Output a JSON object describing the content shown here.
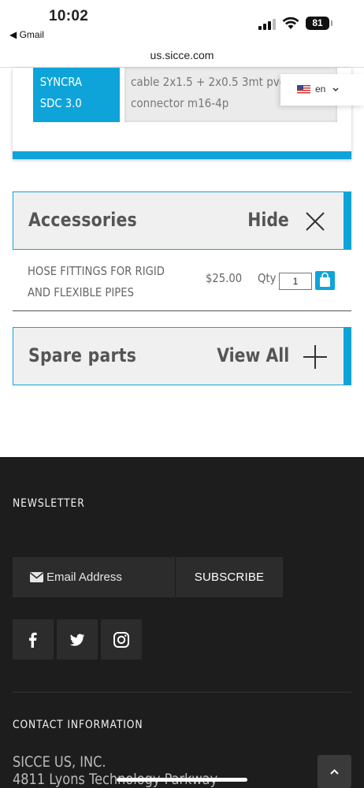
{
  "status_bar": {
    "time": "10:02",
    "back_label": "◀ Gmail",
    "battery": "81"
  },
  "browser": {
    "url": "us.sicce.com"
  },
  "product": {
    "model": [
      "SYNCRA",
      "SDC 3.0"
    ],
    "spec": [
      "cable 2x1.5 + 2x0.5 3mt pvc",
      "connector m16-4p"
    ]
  },
  "language": {
    "code": "en"
  },
  "accessories": {
    "title": "Accessories",
    "action": "Hide",
    "items": [
      {
        "name": [
          "HOSE FITTINGS FOR RIGID",
          "AND FLEXIBLE PIPES"
        ],
        "price": "$25.00",
        "qty_label": "Qty",
        "qty": "1"
      }
    ]
  },
  "spare_parts": {
    "title": "Spare parts",
    "action": "View All"
  },
  "footer": {
    "newsletter_heading": "NEWSLETTER",
    "email_placeholder": "Email Address",
    "subscribe_label": "SUBSCRIBE",
    "contact_heading": "CONTACT INFORMATION",
    "company_lines": [
      "SICCE US, INC.",
      "4811 Lyons Technology Parkway"
    ]
  },
  "colors": {
    "accent": "#0fa4d9",
    "footer_bg": "#1d1d1d"
  },
  "icons": [
    "wifi-icon",
    "signal-icon",
    "close-icon",
    "plus-icon",
    "cart-icon",
    "envelope-icon",
    "facebook-icon",
    "twitter-icon",
    "instagram-icon",
    "chevron-up-icon"
  ]
}
